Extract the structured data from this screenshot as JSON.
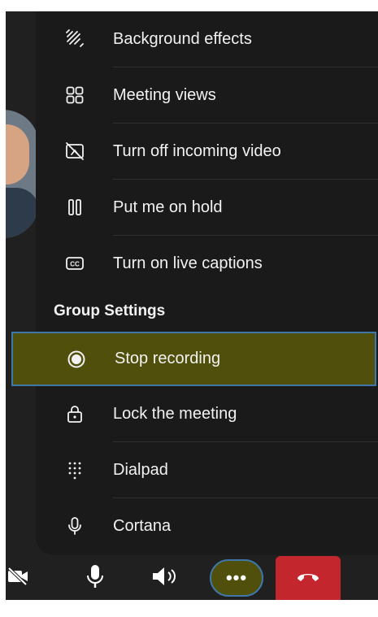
{
  "menu": {
    "items": [
      {
        "label": "Background effects",
        "icon": "background-effects-icon"
      },
      {
        "label": "Meeting views",
        "icon": "meeting-views-icon"
      },
      {
        "label": "Turn off incoming video",
        "icon": "video-off-icon"
      },
      {
        "label": "Put me on hold",
        "icon": "hold-icon"
      },
      {
        "label": "Turn on live captions",
        "icon": "captions-icon"
      }
    ],
    "group_header": "Group Settings",
    "group_items": [
      {
        "label": "Stop recording",
        "icon": "record-icon",
        "highlighted": true
      },
      {
        "label": "Lock the meeting",
        "icon": "lock-icon"
      },
      {
        "label": "Dialpad",
        "icon": "dialpad-icon"
      },
      {
        "label": "Cortana",
        "icon": "microphone-icon"
      }
    ]
  },
  "bottom_bar": {
    "camera_icon": "camera-off-icon",
    "mic_icon": "microphone-icon",
    "speaker_icon": "speaker-icon",
    "more_label": "•••",
    "hangup_icon": "hang-up-icon"
  },
  "colors": {
    "background": "#202020",
    "menu_background": "#1a1a1a",
    "highlight_fill": "#504f0b",
    "highlight_border": "#3f77a8",
    "hangup": "#c4262d"
  }
}
